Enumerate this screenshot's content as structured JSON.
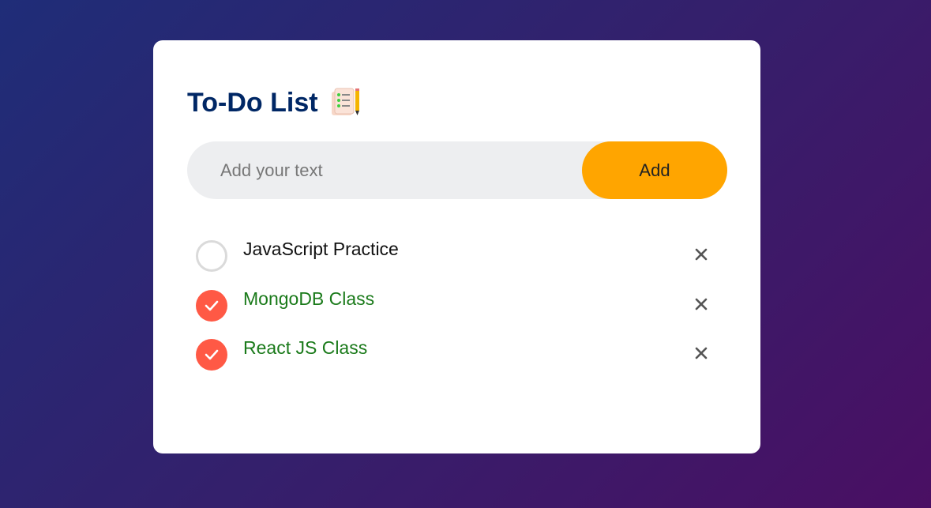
{
  "app": {
    "title": "To-Do List",
    "title_icon": "notepad-checklist-icon"
  },
  "input": {
    "value": "",
    "placeholder": "Add your text"
  },
  "add_button": {
    "label": "Add"
  },
  "tasks": [
    {
      "text": "JavaScript Practice",
      "completed": false
    },
    {
      "text": "MongoDB Class",
      "completed": true
    },
    {
      "text": "React JS Class",
      "completed": true
    }
  ],
  "colors": {
    "primary_text": "#002765",
    "accent": "#ffa500",
    "checked": "#ff5945",
    "completed_text": "#1a7a1a",
    "input_bg": "#edeef0"
  },
  "icons": {
    "unchecked": "circle-icon",
    "checked": "check-circle-icon",
    "delete": "close-icon"
  }
}
